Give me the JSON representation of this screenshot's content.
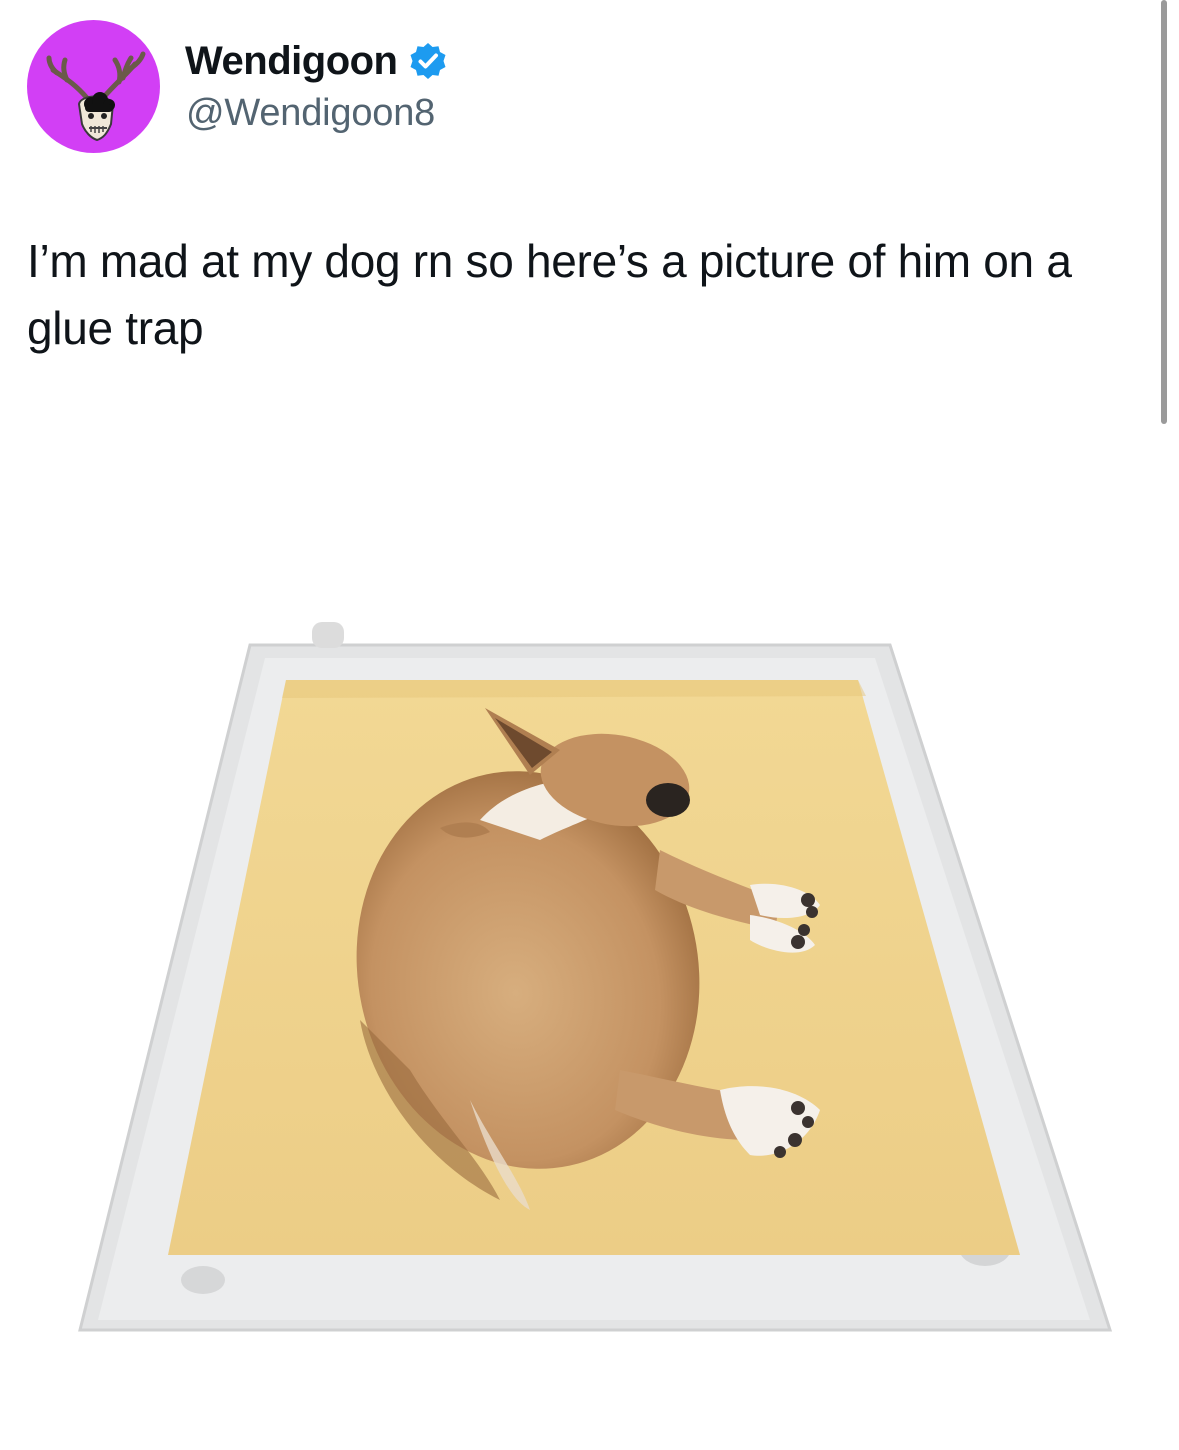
{
  "author": {
    "display_name": "Wendigoon",
    "handle": "@Wendigoon8",
    "verified": true,
    "avatar_icon": "antlered-skull-avatar",
    "avatar_color": "#d23ff5",
    "verified_badge_color": "#1d9bf0"
  },
  "tweet": {
    "text": "I’m mad at my dog rn so here’s a picture of him on a glue trap"
  },
  "media": {
    "icon": "dog-on-glue-trap-photo",
    "trap_color": "#efd18a",
    "frame_color": "#dedfe0"
  },
  "colors": {
    "text_primary": "#0f1419",
    "text_secondary": "#536471",
    "background": "#ffffff"
  }
}
